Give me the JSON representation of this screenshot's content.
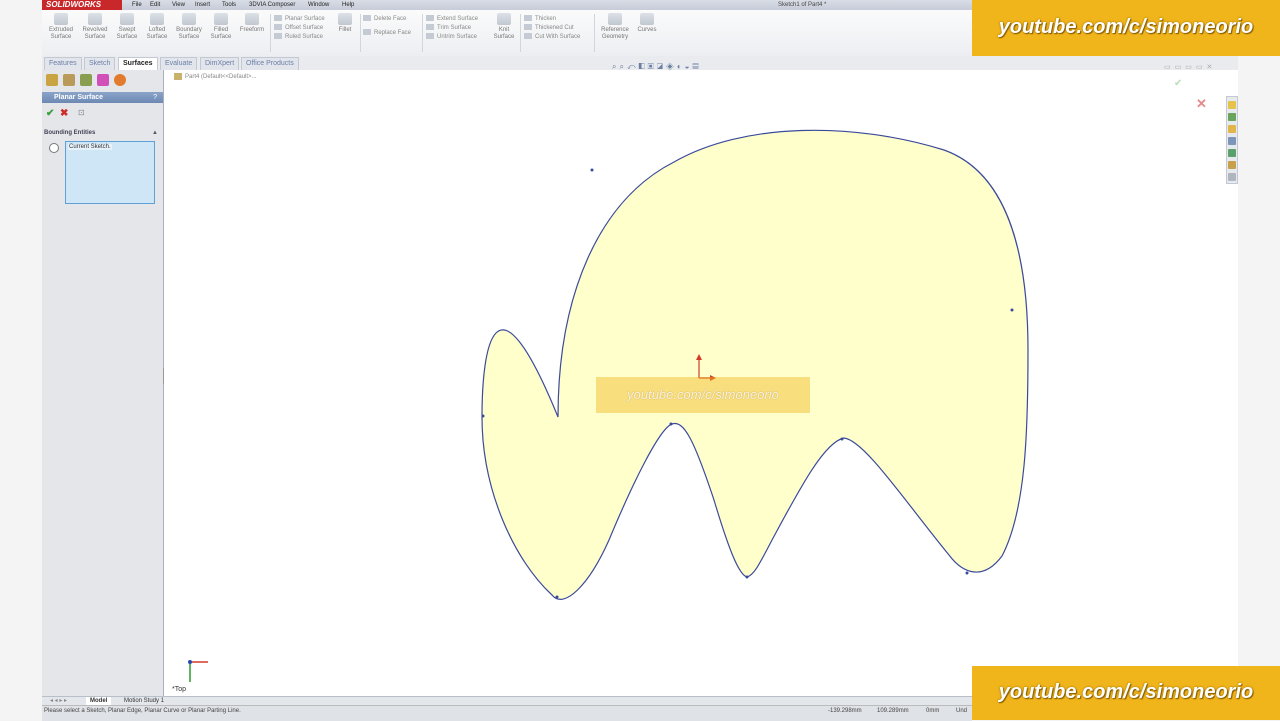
{
  "app": {
    "name": "SOLIDWORKS",
    "document_title": "Sketch1 of Part4 *"
  },
  "menu": [
    "File",
    "Edit",
    "View",
    "Insert",
    "Tools",
    "3DVIA Composer",
    "Window",
    "Help"
  ],
  "ribbon": {
    "buttons": [
      {
        "label": "Extruded\nSurface"
      },
      {
        "label": "Revolved\nSurface"
      },
      {
        "label": "Swept\nSurface"
      },
      {
        "label": "Lofted\nSurface"
      },
      {
        "label": "Boundary\nSurface"
      },
      {
        "label": "Filled\nSurface"
      },
      {
        "label": "Freeform"
      }
    ],
    "group1": [
      "Planar Surface",
      "Offset Surface",
      "Ruled Surface"
    ],
    "fillet": "Fillet",
    "group2": [
      "Delete Face",
      "Replace Face"
    ],
    "group3": [
      "Extend Surface",
      "Trim Surface",
      "Untrim Surface"
    ],
    "knit": "Knit\nSurface",
    "group4": [
      "Thicken",
      "Thickened Cut",
      "Cut With Surface"
    ],
    "reference_geometry": "Reference\nGeometry",
    "curves": "Curves"
  },
  "tabs": [
    {
      "label": "Features",
      "active": false
    },
    {
      "label": "Sketch",
      "active": false
    },
    {
      "label": "Surfaces",
      "active": true
    },
    {
      "label": "Evaluate",
      "active": false
    },
    {
      "label": "DimXpert",
      "active": false
    },
    {
      "label": "Office Products",
      "active": false
    }
  ],
  "property_manager": {
    "title": "Planar Surface",
    "help": "?",
    "section_title": "Bounding Entities",
    "selection_item": "Current Sketch."
  },
  "viewport": {
    "tree_node": "Part4 (Default<<Default>...",
    "view_orientation": "*Top"
  },
  "bottom_tabs": [
    "Model",
    "Motion Study 1"
  ],
  "status": {
    "message": "Please select a Sketch, Planar Edge, Planar Curve or Planar Parting Line.",
    "x": "-139.298mm",
    "y": "109.289mm",
    "z": "0mm",
    "state": "Und"
  },
  "watermark": {
    "text": "youtube.com/c/simoneorio"
  },
  "colors": {
    "sketch_fill": "#ffffcc",
    "sketch_outline": "#3b4a9a",
    "watermark_bg": "#f0b51b",
    "active_tab": "#ffffff"
  }
}
